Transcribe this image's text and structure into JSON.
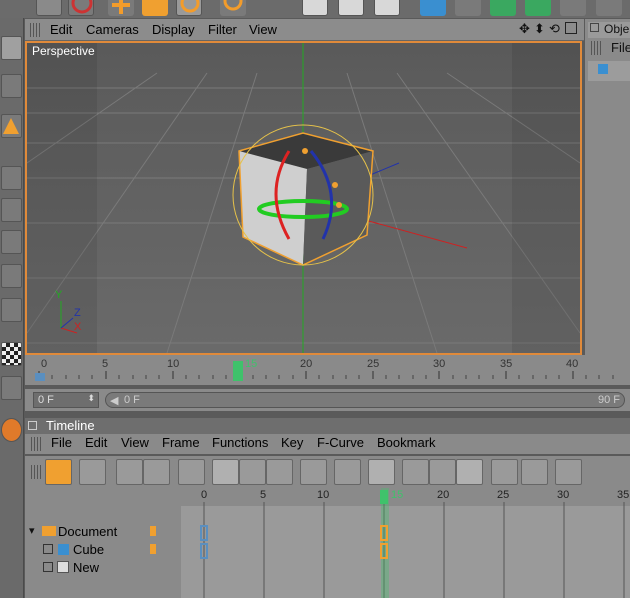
{
  "menubar": {
    "items": [
      "Edit",
      "Cameras",
      "Display",
      "Filter",
      "View"
    ]
  },
  "viewport": {
    "label": "Perspective",
    "axis_labels": {
      "x": "X",
      "y": "Y",
      "z": "Z"
    }
  },
  "object_panel": {
    "tab_label": "Obje",
    "menu_label": "File"
  },
  "frame_ruler": {
    "ticks": [
      "0",
      "5",
      "10",
      "15",
      "20",
      "25",
      "30",
      "35",
      "40"
    ],
    "current_frame": "15"
  },
  "frame_slider": {
    "start_field": "0 F",
    "current_field": "0 F",
    "end_field": "90 F"
  },
  "timeline": {
    "title": "Timeline",
    "menu": [
      "File",
      "Edit",
      "View",
      "Frame",
      "Functions",
      "Key",
      "F-Curve",
      "Bookmark"
    ],
    "ruler_ticks": [
      "0",
      "5",
      "10",
      "15",
      "20",
      "25",
      "30",
      "35"
    ],
    "current_frame": "15",
    "tree": [
      {
        "label": "Document"
      },
      {
        "label": "Cube"
      },
      {
        "label": "New"
      }
    ]
  },
  "colors": {
    "accent": "#e08a3a",
    "playhead": "#3fc26b",
    "x_axis": "#cc2222",
    "y_axis": "#22aa22",
    "z_axis": "#2233aa"
  },
  "icons": {
    "toolbar": [
      "undo-icon",
      "move-icon",
      "scale-icon",
      "rotate-icon",
      "render-icon",
      "cube-icon",
      "light-icon"
    ],
    "left_column": [
      "layout-icon",
      "world-icon",
      "polygon-icon",
      "axis-icon",
      "model-icon",
      "points-icon",
      "edges-icon",
      "polygons-icon",
      "texture-icon",
      "checker-icon",
      "sphere-icon"
    ],
    "timeline_tools": [
      "key-icon",
      "select-key-icon",
      "fcurve-icon",
      "curve-icon",
      "record-icon",
      "magnet-icon",
      "move-key-icon",
      "ease-icon",
      "linear-icon",
      "film-icon",
      "spline-icon",
      "step-icon",
      "smooth-icon",
      "auto-icon",
      "delete-key-icon",
      "add-key-icon",
      "play-icon"
    ]
  }
}
